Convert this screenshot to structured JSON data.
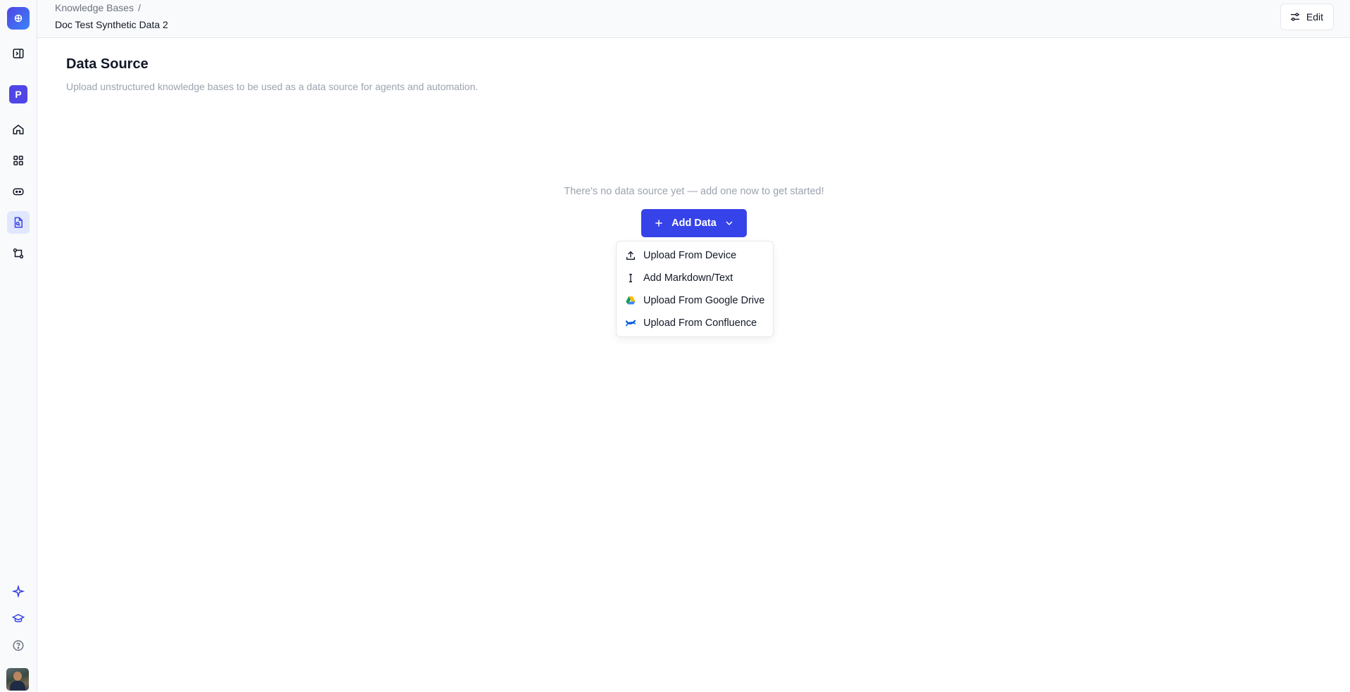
{
  "sidebar": {
    "workspace_initial": "P",
    "items": [
      {
        "name": "collapse-sidebar-icon"
      },
      {
        "name": "home-icon"
      },
      {
        "name": "apps-grid-icon"
      },
      {
        "name": "agents-icon"
      },
      {
        "name": "knowledge-base-icon",
        "active": true
      },
      {
        "name": "workflow-icon"
      }
    ],
    "bottom_items": [
      {
        "name": "sparkle-icon"
      },
      {
        "name": "graduation-cap-icon"
      },
      {
        "name": "help-icon"
      }
    ]
  },
  "header": {
    "breadcrumb_parent": "Knowledge Bases",
    "breadcrumb_separator": "/",
    "breadcrumb_current": "Doc Test Synthetic Data 2",
    "edit_label": "Edit"
  },
  "main": {
    "title": "Data Source",
    "subtitle": "Upload unstructured knowledge bases to be used as a data source for agents and automation.",
    "empty_message": "There's no data source yet — add one now to get started!",
    "add_button_label": "Add Data"
  },
  "dropdown": {
    "items": [
      {
        "label": "Upload From Device",
        "icon": "upload-icon"
      },
      {
        "label": "Add Markdown/Text",
        "icon": "text-cursor-icon"
      },
      {
        "label": "Upload From Google Drive",
        "icon": "google-drive-icon"
      },
      {
        "label": "Upload From Confluence",
        "icon": "confluence-icon"
      }
    ]
  },
  "colors": {
    "accent": "#3643e8",
    "brand": "#4f46e5",
    "muted_text": "#9ca3af"
  }
}
